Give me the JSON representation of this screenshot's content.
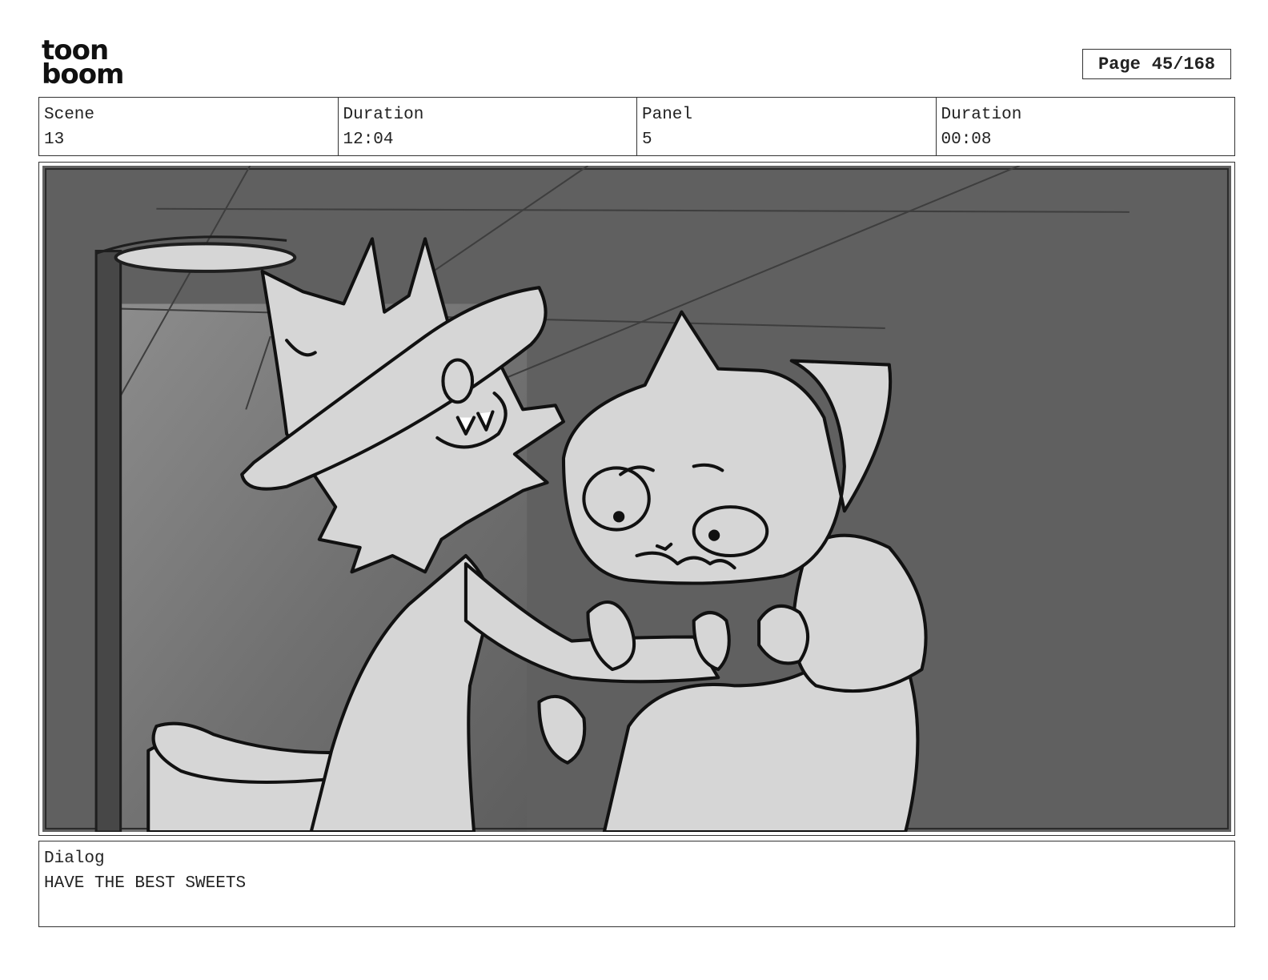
{
  "logo": {
    "line1": "toon",
    "line2": "boom"
  },
  "page": {
    "label": "Page",
    "value": "45/168"
  },
  "info": [
    {
      "header": "Scene",
      "value": "13"
    },
    {
      "header": "Duration",
      "value": "12:04"
    },
    {
      "header": "Panel",
      "value": "5"
    },
    {
      "header": "Duration",
      "value": "00:08"
    }
  ],
  "dialog": {
    "header": "Dialog",
    "text": "HAVE THE BEST SWEETS"
  },
  "colors": {
    "wall": "#666666",
    "wall_light": "#8a8a8a",
    "fill": "#d6d6d6",
    "line": "#111111"
  }
}
